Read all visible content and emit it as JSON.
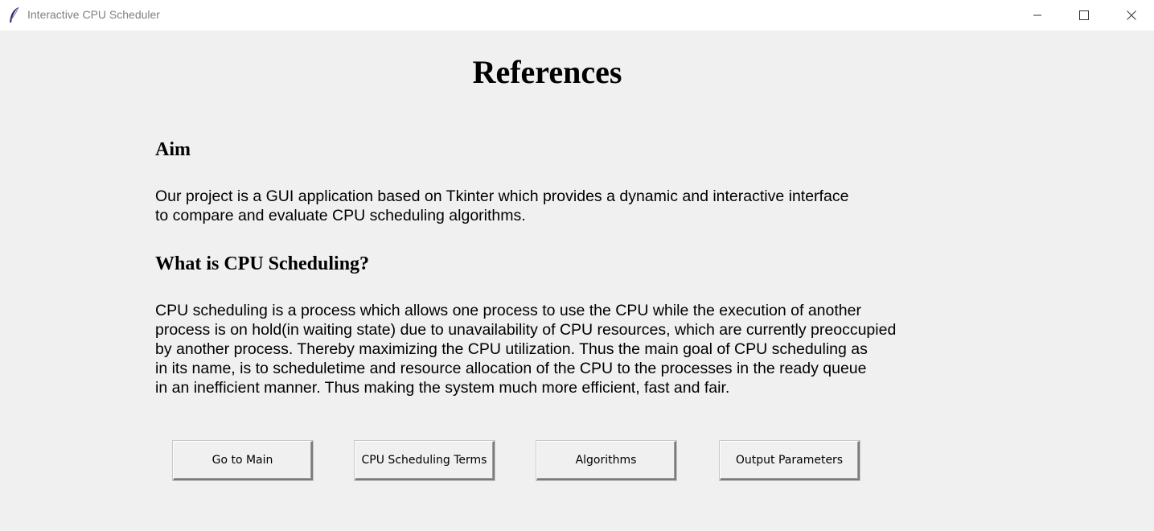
{
  "window": {
    "title": "Interactive CPU Scheduler",
    "icon": "feather-icon"
  },
  "page": {
    "title": "References",
    "sections": [
      {
        "heading": "Aim",
        "body": "Our project is a GUI application based on Tkinter which provides a dynamic and interactive interface\nto compare and evaluate CPU scheduling algorithms."
      },
      {
        "heading": "What is CPU Scheduling?",
        "body": "CPU scheduling is a process which allows one process to use the CPU while the execution of another\nprocess is on hold(in waiting state) due to unavailability of CPU resources, which are currently preoccupied\nby another process. Thereby maximizing the CPU utilization. Thus the main goal of CPU scheduling as\nin its name, is to scheduletime and resource allocation of the CPU to the processes in the ready queue\nin an inefficient manner. Thus making the system much more efficient, fast and fair."
      }
    ]
  },
  "buttons": {
    "main": "Go to Main",
    "terms": "CPU Scheduling Terms",
    "algorithms": "Algorithms",
    "output": "Output Parameters"
  }
}
